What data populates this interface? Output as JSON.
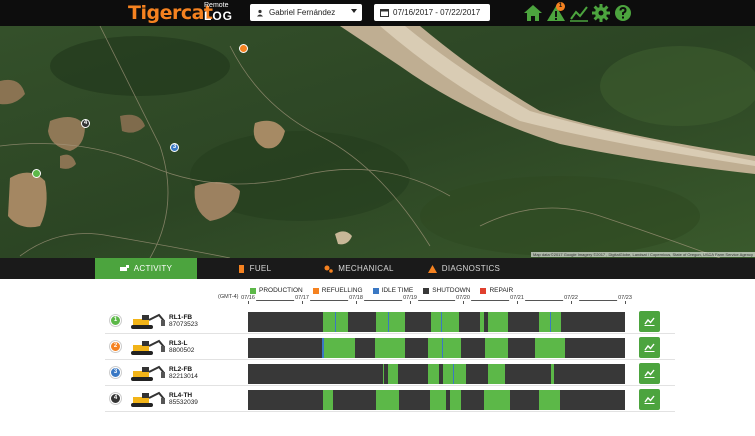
{
  "header": {
    "brand": "Tigercat",
    "brand_sub_top": "Remote",
    "brand_sub_bottom": "LOG",
    "user": "Gabriel Fernández",
    "date_range": "07/16/2017 - 07/22/2017",
    "icons": [
      "home-icon",
      "alert-icon",
      "activity-chart-icon",
      "settings-icon",
      "help-icon"
    ],
    "alert_count": "1",
    "accent_color": "#4ca43e",
    "brand_color": "#f58220"
  },
  "map": {
    "attribution": "Map data ©2017 Google Imagery ©2017 , DigitalGlobe, Landsat / Copernicus, State of Oregon, USDA Farm Service Agency",
    "pins": [
      {
        "label": "",
        "color": "#f58220"
      },
      {
        "label": "4",
        "color": "#333333"
      },
      {
        "label": "3",
        "color": "#3a78c4"
      },
      {
        "label": "",
        "color": "#5cb848"
      }
    ]
  },
  "tabs": [
    {
      "label": "ACTIVITY",
      "icon": "machine-icon",
      "active": true
    },
    {
      "label": "FUEL",
      "icon": "fuel-icon",
      "active": false
    },
    {
      "label": "MECHANICAL",
      "icon": "gears-icon",
      "active": false
    },
    {
      "label": "DIAGNOSTICS",
      "icon": "warning-icon",
      "active": false
    }
  ],
  "activity": {
    "timezone": "(GMT-4)",
    "legend": [
      {
        "label": "PRODUCTION",
        "color": "#5cb848"
      },
      {
        "label": "REFUELLING",
        "color": "#f58220"
      },
      {
        "label": "IDLE TIME",
        "color": "#3a78c4"
      },
      {
        "label": "SHUTDOWN",
        "color": "#383838"
      },
      {
        "label": "REPAIR",
        "color": "#e0402e"
      }
    ],
    "axis_days": [
      "07/16",
      "07/17",
      "07/18",
      "07/19",
      "07/20",
      "07/21",
      "07/22",
      "07/23"
    ],
    "machines": [
      {
        "number": "1",
        "name": "RL1-FB",
        "serial": "87073523",
        "badge_color": "#5cb848",
        "segments": [
          {
            "state": "production",
            "start": 1.39,
            "end": 1.85
          },
          {
            "state": "idle",
            "start": 1.62,
            "end": 1.64
          },
          {
            "state": "production",
            "start": 2.38,
            "end": 2.92
          },
          {
            "state": "idle",
            "start": 2.6,
            "end": 2.62
          },
          {
            "state": "production",
            "start": 3.4,
            "end": 3.92
          },
          {
            "state": "idle",
            "start": 3.58,
            "end": 3.6
          },
          {
            "state": "production",
            "start": 4.3,
            "end": 4.38
          },
          {
            "state": "production",
            "start": 4.45,
            "end": 4.82
          },
          {
            "state": "production",
            "start": 5.4,
            "end": 5.82
          },
          {
            "state": "idle",
            "start": 5.6,
            "end": 5.62
          }
        ]
      },
      {
        "number": "2",
        "name": "RL3-L",
        "serial": "8800502",
        "badge_color": "#f58220",
        "segments": [
          {
            "state": "idle",
            "start": 1.38,
            "end": 1.42
          },
          {
            "state": "production",
            "start": 1.42,
            "end": 1.98
          },
          {
            "state": "production",
            "start": 2.35,
            "end": 2.92
          },
          {
            "state": "production",
            "start": 3.35,
            "end": 3.95
          },
          {
            "state": "idle",
            "start": 3.6,
            "end": 3.62
          },
          {
            "state": "production",
            "start": 4.4,
            "end": 4.82
          },
          {
            "state": "production",
            "start": 5.32,
            "end": 5.88
          }
        ]
      },
      {
        "number": "3",
        "name": "RL2-FB",
        "serial": "82213014",
        "badge_color": "#3a78c4",
        "segments": [
          {
            "state": "production",
            "start": 2.5,
            "end": 2.53
          },
          {
            "state": "production",
            "start": 2.6,
            "end": 2.78
          },
          {
            "state": "production",
            "start": 3.35,
            "end": 3.55
          },
          {
            "state": "production",
            "start": 3.62,
            "end": 4.05
          },
          {
            "state": "idle",
            "start": 3.8,
            "end": 3.82
          },
          {
            "state": "production",
            "start": 4.45,
            "end": 4.78
          },
          {
            "state": "production",
            "start": 5.62,
            "end": 5.68
          }
        ]
      },
      {
        "number": "4",
        "name": "RL4-TH",
        "serial": "85532039",
        "badge_color": "#333333",
        "segments": [
          {
            "state": "production",
            "start": 1.39,
            "end": 1.57
          },
          {
            "state": "production",
            "start": 2.38,
            "end": 2.8
          },
          {
            "state": "production",
            "start": 3.38,
            "end": 3.68
          },
          {
            "state": "production",
            "start": 3.75,
            "end": 3.95
          },
          {
            "state": "production",
            "start": 4.38,
            "end": 4.86
          },
          {
            "state": "production",
            "start": 5.4,
            "end": 5.8
          }
        ]
      }
    ]
  }
}
